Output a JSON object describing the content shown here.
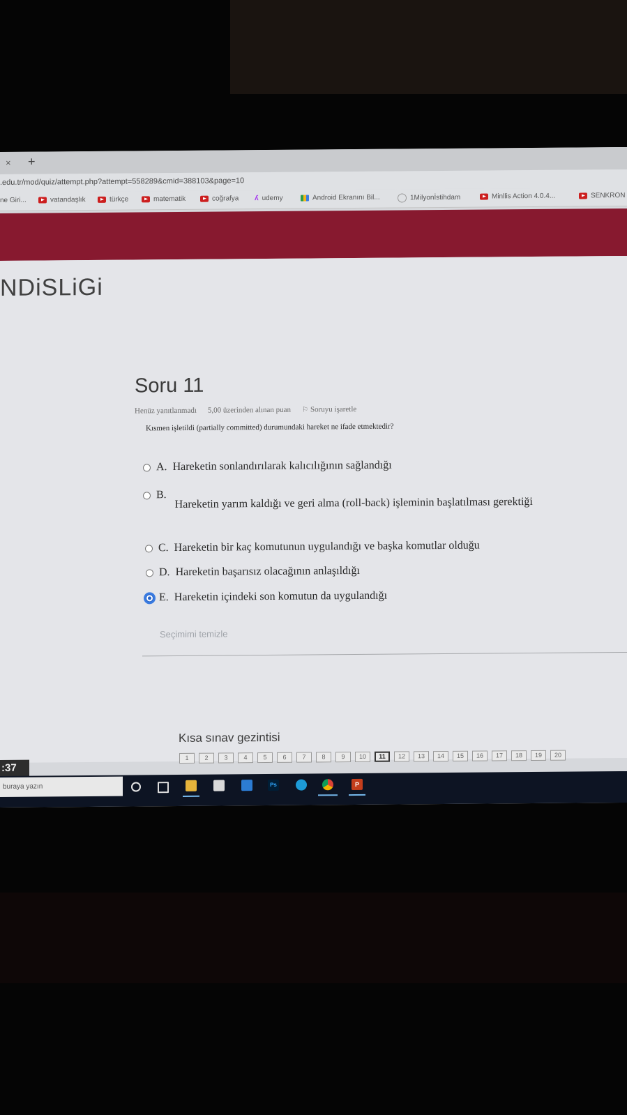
{
  "browser": {
    "tab_close_glyph": "×",
    "tab_new_glyph": "+",
    "url": ".edu.tr/mod/quiz/attempt.php?attempt=558289&cmid=388103&page=10",
    "bookmarks": [
      {
        "label": "ne Giri...",
        "icon": "none"
      },
      {
        "label": "vatandaşlık",
        "icon": "youtube-icon"
      },
      {
        "label": "türkçe",
        "icon": "youtube-icon"
      },
      {
        "label": "matematik",
        "icon": "youtube-icon"
      },
      {
        "label": "coğrafya",
        "icon": "youtube-icon"
      },
      {
        "label": "udemy",
        "icon": "udemy-icon"
      },
      {
        "label": "Android Ekranını Bil...",
        "icon": "android-icon"
      },
      {
        "label": "1Milyonİstihdam",
        "icon": "globe-icon"
      },
      {
        "label": "Minllis Action 4.0.4...",
        "icon": "youtube-icon"
      },
      {
        "label": "SENKRON",
        "icon": "youtube-icon"
      }
    ]
  },
  "site": {
    "title": "NDiSLiGi",
    "banner_color": "#87192f"
  },
  "question": {
    "title": "Soru 11",
    "status": "Henüz yanıtlanmadı",
    "points": "5,00 üzerinden alınan puan",
    "flag_label": "Soruyu işaretle",
    "text": "Kısmen işletildi (partially committed) durumundaki hareket ne ifade etmektedir?",
    "options": [
      {
        "label": "A.",
        "text": "Hareketin sonlandırılarak kalıcılığının sağlandığı",
        "checked": false
      },
      {
        "label": "B.",
        "text": "Hareketin yarım kaldığı ve geri alma (roll-back) işleminin başlatılması gerektiği",
        "checked": false
      },
      {
        "label": "C.",
        "text": "Hareketin bir kaç komutunun uygulandığı ve başka komutlar olduğu",
        "checked": false
      },
      {
        "label": "D.",
        "text": "Hareketin başarısız olacağının anlaşıldığı",
        "checked": false
      },
      {
        "label": "E.",
        "text": "Hareketin içindeki son komutun da uygulandığı",
        "checked": true
      }
    ],
    "clear_label": "Seçimimi temizle"
  },
  "quiz_nav": {
    "title": "Kısa sınav gezintisi",
    "pages": [
      "1",
      "2",
      "3",
      "4",
      "5",
      "6",
      "7",
      "8",
      "9",
      "10",
      "11",
      "12",
      "13",
      "14",
      "15",
      "16",
      "17",
      "18",
      "19",
      "20"
    ],
    "current": "11"
  },
  "timer": {
    "text": ":37"
  },
  "taskbar": {
    "search_placeholder": "buraya yazın",
    "accent": "#76b9ed",
    "apps": [
      "cortana-icon",
      "task-view-icon",
      "file-explorer-icon",
      "store-icon",
      "mail-icon",
      "photoshop-icon",
      "edge-icon",
      "chrome-icon",
      "powerpoint-icon"
    ],
    "ps_label": "Ps",
    "ppt_label": "P"
  }
}
